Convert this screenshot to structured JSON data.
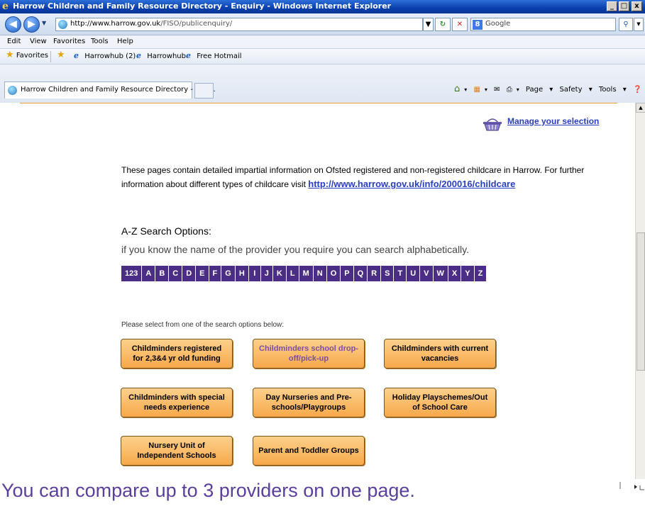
{
  "window": {
    "title": "Harrow Children and Family Resource Directory - Enquiry - Windows Internet Explorer",
    "controls": [
      "_",
      "□",
      "x"
    ]
  },
  "address_bar": {
    "url_prefix": "http://www.harrow.gov.uk",
    "url_path": "/FISO/publicenquiry/",
    "search_placeholder": "Google"
  },
  "menu": [
    "Edit",
    "View",
    "Favorites",
    "Tools",
    "Help"
  ],
  "favorites_bar": {
    "label": "Favorites",
    "items": [
      "Harrowhub (2)",
      "Harrowhub",
      "Free Hotmail"
    ]
  },
  "tab": {
    "label": "Harrow Children and Family Resource Directory - Enq..."
  },
  "command_bar": [
    "Page",
    "Safety",
    "Tools"
  ],
  "page": {
    "manage_selection": "Manage your selection",
    "intro_text": "These pages contain detailed impartial information on Ofsted registered and non-registered childcare in Harrow. For further information about different types of childcare visit",
    "intro_link": "http://www.harrow.gov.uk/info/200016/childcare",
    "az_heading": "A-Z Search Options:",
    "az_subtext": "if you know the name of the provider you require you can search alphabetically.",
    "az_letters": [
      "123",
      "A",
      "B",
      "C",
      "D",
      "E",
      "F",
      "G",
      "H",
      "I",
      "J",
      "K",
      "L",
      "M",
      "N",
      "O",
      "P",
      "Q",
      "R",
      "S",
      "T",
      "U",
      "V",
      "W",
      "X",
      "Y",
      "Z"
    ],
    "select_label": "Please select from one of the search options below:",
    "options": [
      "Childminders registered for 2,3&4 yr old funding",
      "Childminders school drop-off/pick-up",
      "Childminders with current vacancies",
      "Childminders with special needs experience",
      "Day Nurseries and Pre-schools/Playgroups",
      "Holiday Playschemes/Out of School Care",
      "Nursery Unit of Independent Schools",
      "Parent and Toddler Groups"
    ]
  },
  "caption": "You can compare up to 3 providers on one page.",
  "colors": {
    "link": "#2a3fbf",
    "az_background": "#4c2d86",
    "button_orange": "#f7a94a",
    "caption_purple": "#5b3f9c"
  }
}
